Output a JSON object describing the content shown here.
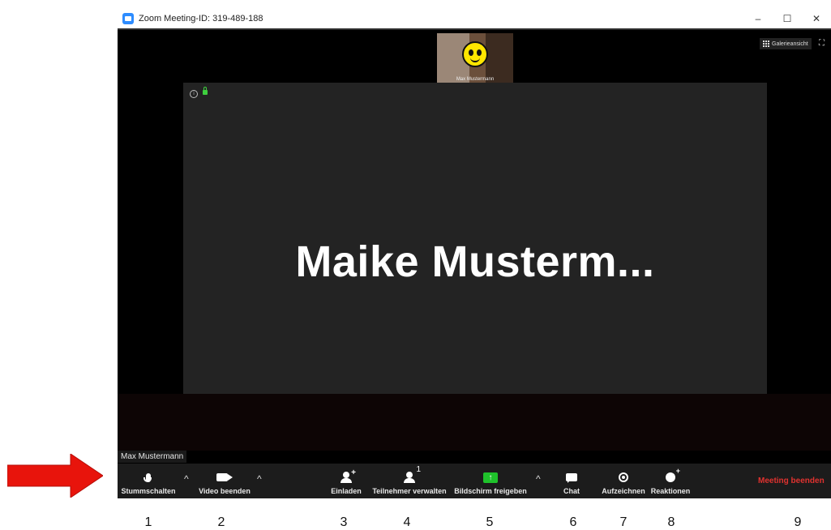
{
  "window": {
    "title": "Zoom Meeting-ID: 319-489-188",
    "controls": [
      "–",
      "☐",
      "✕"
    ]
  },
  "thumbnail": {
    "name": "Max Mustermann"
  },
  "view": {
    "gallery_label": "Galerieansicht"
  },
  "stage": {
    "speaker_name": "Maike  Musterm..."
  },
  "name_tag": "Max Mustermann",
  "toolbar": {
    "mute_label": "Stummschalten",
    "video_label": "Video beenden",
    "invite_label": "Einladen",
    "participants_label": "Teilnehmer verwalten",
    "participants_count": "1",
    "share_label": "Bildschirm freigeben",
    "chat_label": "Chat",
    "record_label": "Aufzeichnen",
    "reactions_label": "Reaktionen",
    "end_label": "Meeting beenden"
  },
  "annotations": {
    "numbers": [
      "1",
      "2",
      "3",
      "4",
      "5",
      "6",
      "7",
      "8",
      "9"
    ],
    "arrow_color": "#e8140c"
  },
  "colors": {
    "share_green": "#1fc22b",
    "end_red": "#e0322f",
    "zoom_blue": "#2d8cff"
  }
}
